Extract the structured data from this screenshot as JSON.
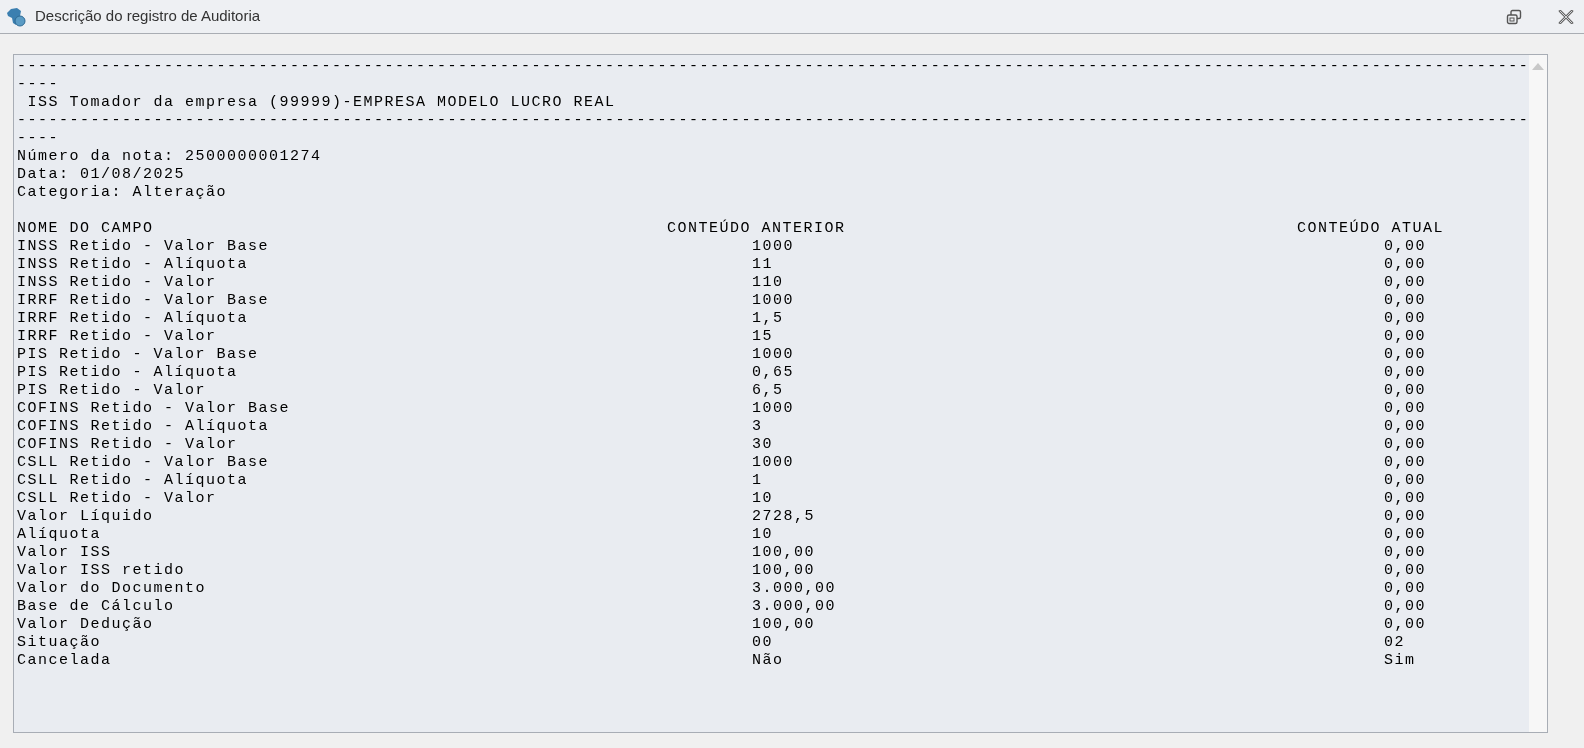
{
  "window": {
    "title": "Descrição do registro de Auditoria"
  },
  "report": {
    "header_lines": [
      "------------------------------------------------------------------------------------------------------------------------------------------------",
      "----",
      " ISS Tomador da empresa (99999)-EMPRESA MODELO LUCRO REAL",
      "------------------------------------------------------------------------------------------------------------------------------------------------",
      "----",
      "Número da nota: 2500000001274",
      "Data: 01/08/2025",
      "Categoria: Alteração"
    ],
    "columns": [
      "NOME DO CAMPO",
      "CONTEÚDO ANTERIOR",
      "CONTEÚDO ATUAL"
    ],
    "rows": [
      {
        "field": "INSS Retido - Valor Base",
        "previous": "1000",
        "current": "0,00"
      },
      {
        "field": "INSS Retido - Alíquota",
        "previous": "11",
        "current": "0,00"
      },
      {
        "field": "INSS Retido - Valor",
        "previous": "110",
        "current": "0,00"
      },
      {
        "field": "IRRF Retido - Valor Base",
        "previous": "1000",
        "current": "0,00"
      },
      {
        "field": "IRRF Retido - Alíquota",
        "previous": "1,5",
        "current": "0,00"
      },
      {
        "field": "IRRF Retido - Valor",
        "previous": "15",
        "current": "0,00"
      },
      {
        "field": "PIS Retido - Valor Base",
        "previous": "1000",
        "current": "0,00"
      },
      {
        "field": "PIS Retido - Alíquota",
        "previous": "0,65",
        "current": "0,00"
      },
      {
        "field": "PIS Retido - Valor",
        "previous": "6,5",
        "current": "0,00"
      },
      {
        "field": "COFINS Retido - Valor Base",
        "previous": "1000",
        "current": "0,00"
      },
      {
        "field": "COFINS Retido - Alíquota",
        "previous": "3",
        "current": "0,00"
      },
      {
        "field": "COFINS Retido - Valor",
        "previous": "30",
        "current": "0,00"
      },
      {
        "field": "CSLL Retido - Valor Base",
        "previous": "1000",
        "current": "0,00"
      },
      {
        "field": "CSLL Retido - Alíquota",
        "previous": "1",
        "current": "0,00"
      },
      {
        "field": "CSLL Retido - Valor",
        "previous": "10",
        "current": "0,00"
      },
      {
        "field": "Valor Líquido",
        "previous": "2728,5",
        "current": "0,00"
      },
      {
        "field": "Alíquota",
        "previous": "10",
        "current": "0,00"
      },
      {
        "field": "Valor ISS",
        "previous": "100,00",
        "current": "0,00"
      },
      {
        "field": "Valor ISS retido",
        "previous": "100,00",
        "current": "0,00"
      },
      {
        "field": "Valor do Documento",
        "previous": "3.000,00",
        "current": "0,00"
      },
      {
        "field": "Base de Cálculo",
        "previous": "3.000,00",
        "current": "0,00"
      },
      {
        "field": "Valor Dedução",
        "previous": "100,00",
        "current": "0,00"
      },
      {
        "field": "Situação",
        "previous": "00",
        "current": "02"
      },
      {
        "field": "Cancelada",
        "previous": "Não",
        "current": "Sim"
      }
    ]
  }
}
